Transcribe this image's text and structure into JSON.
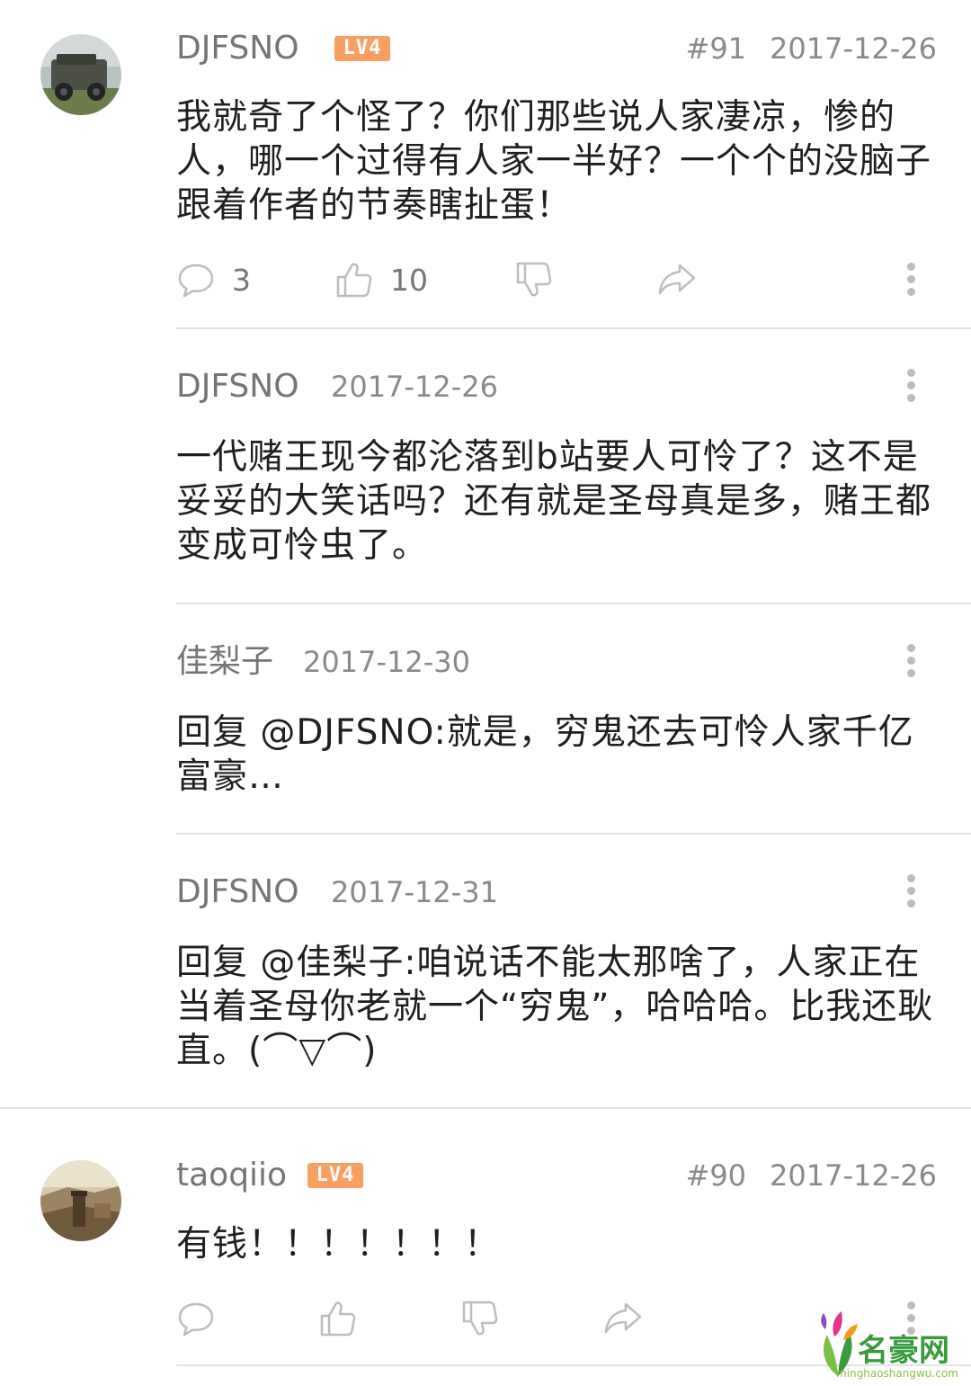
{
  "comments": [
    {
      "username": "DJFSNO",
      "level": "LV4",
      "floor": "#91",
      "date": "2017-12-26",
      "content": "我就奇了个怪了？你们那些说人家凄凉，惨的人，哪一个过得有人家一半好？一个个的没脑子跟着作者的节奏瞎扯蛋！",
      "reply_count": "3",
      "like_count": "10"
    },
    {
      "username": "taoqiio",
      "level": "LV4",
      "floor": "#90",
      "date": "2017-12-26",
      "content": "有钱！！！！！！！",
      "reply_count": "",
      "like_count": ""
    }
  ],
  "replies": [
    {
      "username": "DJFSNO",
      "date": "2017-12-26",
      "content": "一代赌王现今都沦落到b站要人可怜了？这不是妥妥的大笑话吗？还有就是圣母真是多，赌王都变成可怜虫了。"
    },
    {
      "username": "佳梨子",
      "date": "2017-12-30",
      "content": "回复 @DJFSNO:就是，穷鬼还去可怜人家千亿富豪…"
    },
    {
      "username": "DJFSNO",
      "date": "2017-12-31",
      "content": "回复 @佳梨子:咱说话不能太那啥了，人家正在当着圣母你老就一个“穷鬼”，哈哈哈。比我还耿直。(⌒▽⌒)"
    }
  ],
  "watermark": {
    "title": "名豪网",
    "url": "minghaoshangwu.com"
  },
  "colors": {
    "level_badge": "#f8a061",
    "meta_text": "#8a8a8a",
    "divider": "#e3e3e3",
    "icon_stroke": "#bdbdbd"
  },
  "icons": [
    "reply-icon",
    "like-icon",
    "dislike-icon",
    "share-icon",
    "more-icon"
  ]
}
